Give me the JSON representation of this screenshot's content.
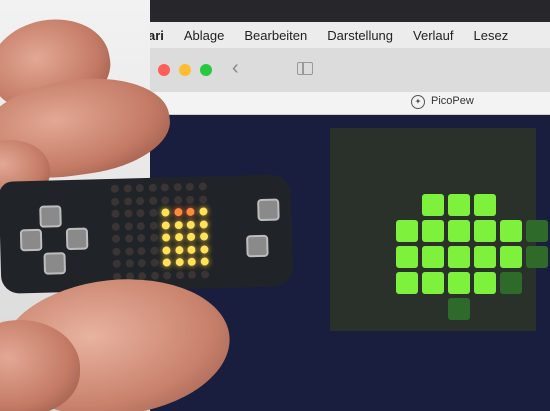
{
  "menubar": {
    "apple_label": "",
    "app_name": "Safari",
    "items": [
      "Ablage",
      "Bearbeiten",
      "Darstellung",
      "Verlauf",
      "Lesez"
    ]
  },
  "browser": {
    "tab_title": "PicoPew"
  },
  "colors": {
    "emulator_pixel_on": "#7df13b",
    "emulator_pixel_dim": "#2e6a2a",
    "board_led_on": "#ffe15a",
    "board_led_hot": "#ff8a3c"
  },
  "icons": {
    "apple": "apple-icon",
    "back": "chevron-left-icon",
    "sidebar": "sidebar-icon",
    "tab": "compass-icon"
  }
}
